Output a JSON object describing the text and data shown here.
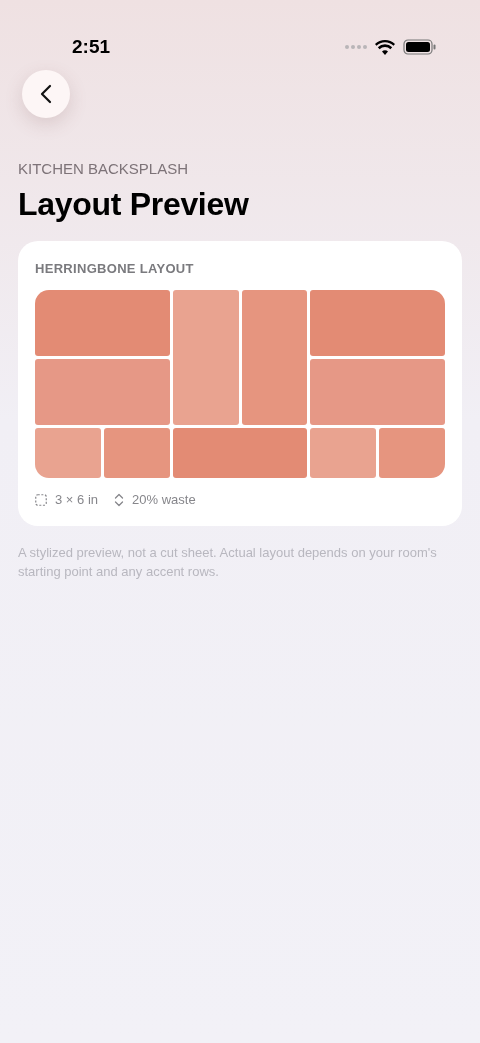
{
  "status_bar": {
    "time": "2:51"
  },
  "header": {
    "eyebrow": "KITCHEN BACKSPLASH",
    "title": "Layout Preview"
  },
  "card": {
    "title": "HERRINGBONE LAYOUT",
    "tiles": [
      {
        "kind": "wide",
        "color": "#e38b74"
      },
      {
        "kind": "tall",
        "color": "#e9a390"
      },
      {
        "kind": "tall",
        "color": "#e6957f"
      },
      {
        "kind": "wide",
        "color": "#e38b74"
      },
      {
        "kind": "wide",
        "color": "#e69886"
      },
      {
        "kind": "wide",
        "color": "#e69886"
      },
      {
        "kind": "small",
        "color": "#e9a390"
      },
      {
        "kind": "small",
        "color": "#e6957f"
      },
      {
        "kind": "wide",
        "color": "#e38b74"
      },
      {
        "kind": "small",
        "color": "#e9a390"
      },
      {
        "kind": "small",
        "color": "#e6957f"
      }
    ],
    "meta": [
      {
        "kind": "size",
        "text": "3 × 6 in"
      },
      {
        "kind": "waste",
        "text": "20% waste"
      }
    ]
  },
  "footnote": "A stylized preview, not a cut sheet. Actual layout depends on your room's starting point and any accent rows."
}
